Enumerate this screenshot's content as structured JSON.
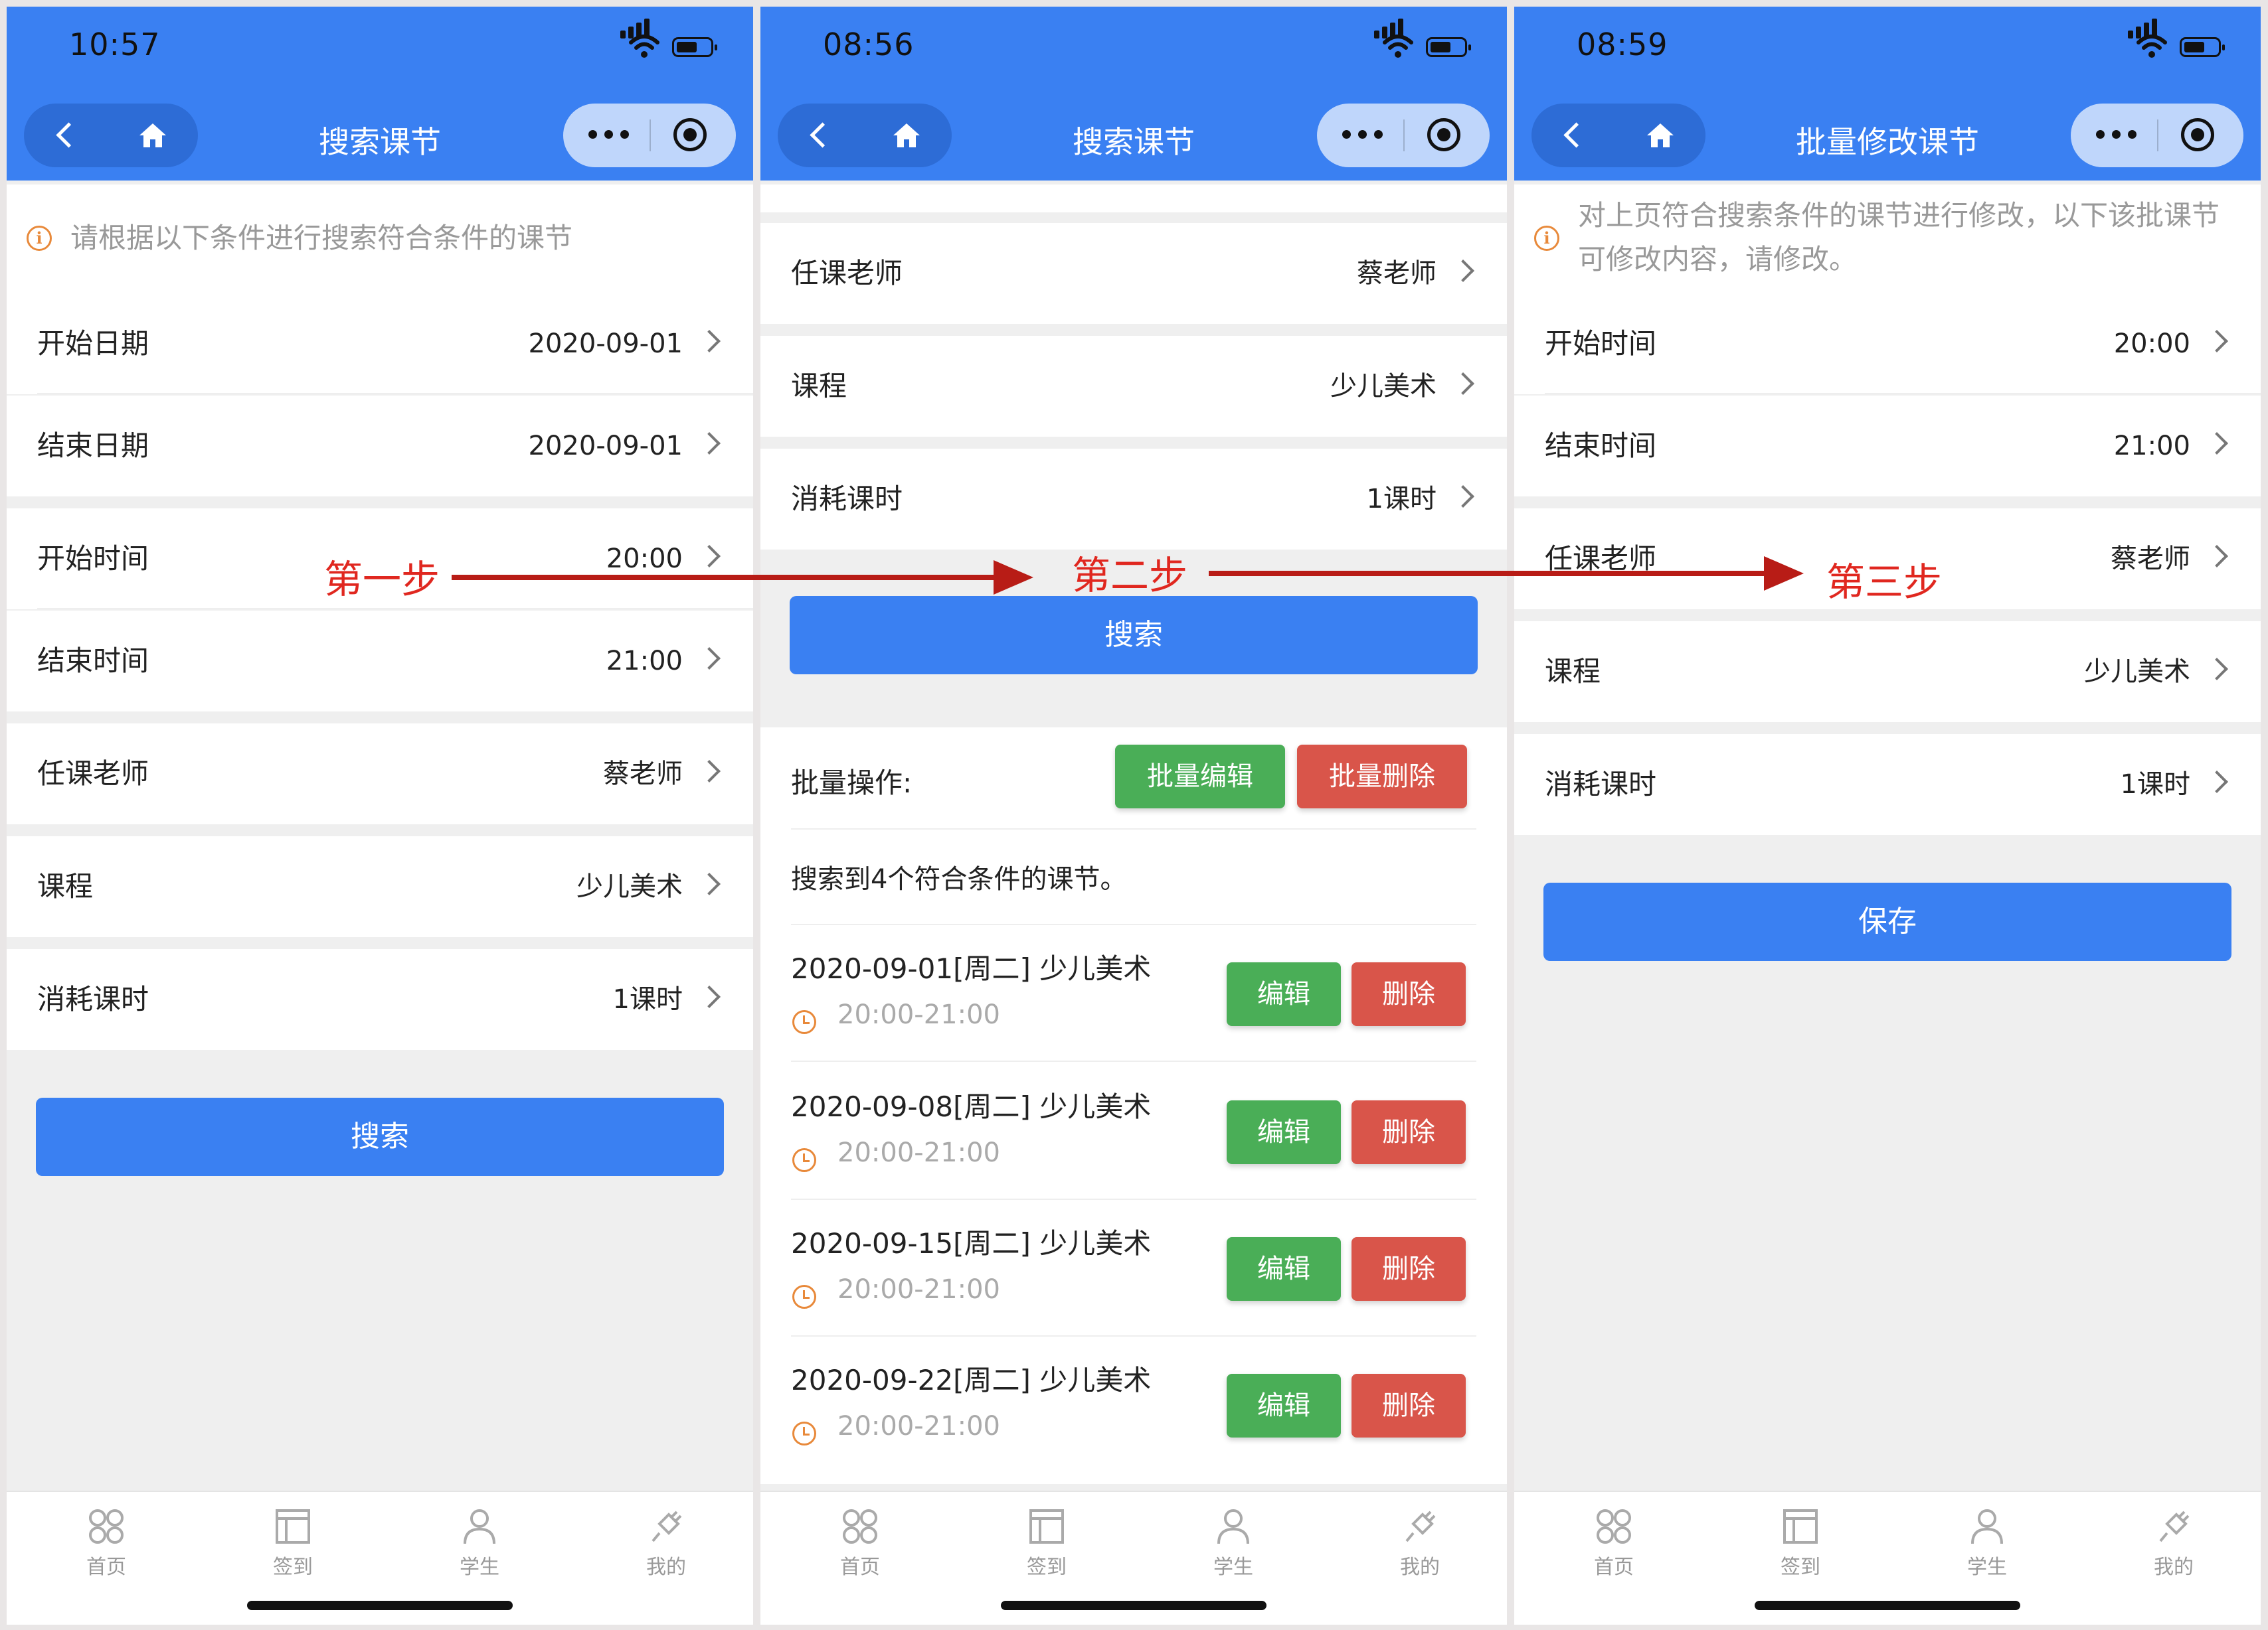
{
  "icons": {
    "back": "chevron-left-icon",
    "home": "home-icon",
    "more": "more-dots-icon",
    "close": "target-icon",
    "notice": "info-icon",
    "clock": "clock-icon",
    "tabs": [
      "grid-icon",
      "book-icon",
      "person-icon",
      "plug-icon"
    ]
  },
  "colors": {
    "primary": "#3a80f2",
    "success": "#4aae57",
    "danger": "#d9554a",
    "step_label": "#e0271f",
    "arrow": "#b81c16",
    "notice_icon": "#e8893a"
  },
  "tabbar": {
    "items": [
      {
        "label": "首页"
      },
      {
        "label": "签到"
      },
      {
        "label": "学生"
      },
      {
        "label": "我的"
      }
    ]
  },
  "steps": [
    "第一步",
    "第二步",
    "第三步"
  ],
  "screen1": {
    "time": "10:57",
    "title": "搜索课节",
    "notice": "请根据以下条件进行搜索符合条件的课节",
    "fields": [
      {
        "label": "开始日期",
        "value": "2020-09-01"
      },
      {
        "label": "结束日期",
        "value": "2020-09-01"
      },
      {
        "label": "开始时间",
        "value": "20:00"
      },
      {
        "label": "结束时间",
        "value": "21:00"
      },
      {
        "label": "任课老师",
        "value": "蔡老师"
      },
      {
        "label": "课程",
        "value": "少儿美术"
      },
      {
        "label": "消耗课时",
        "value": "1课时"
      }
    ],
    "search_button": "搜索"
  },
  "screen2": {
    "time": "08:56",
    "title": "搜索课节",
    "fields": [
      {
        "label": "任课老师",
        "value": "蔡老师"
      },
      {
        "label": "课程",
        "value": "少儿美术"
      },
      {
        "label": "消耗课时",
        "value": "1课时"
      }
    ],
    "search_button": "搜索",
    "batch_label": "批量操作:",
    "batch_edit": "批量编辑",
    "batch_delete": "批量删除",
    "result_summary": "搜索到4个符合条件的课节。",
    "edit_label": "编辑",
    "delete_label": "删除",
    "lessons": [
      {
        "title": "2020-09-01[周二] 少儿美术",
        "time": "20:00-21:00"
      },
      {
        "title": "2020-09-08[周二] 少儿美术",
        "time": "20:00-21:00"
      },
      {
        "title": "2020-09-15[周二] 少儿美术",
        "time": "20:00-21:00"
      },
      {
        "title": "2020-09-22[周二] 少儿美术",
        "time": "20:00-21:00"
      }
    ]
  },
  "screen3": {
    "time": "08:59",
    "title": "批量修改课节",
    "notice": "对上页符合搜索条件的课节进行修改，以下该批课节可修改内容，请修改。",
    "fields": [
      {
        "label": "开始时间",
        "value": "20:00"
      },
      {
        "label": "结束时间",
        "value": "21:00"
      },
      {
        "label": "任课老师",
        "value": "蔡老师"
      },
      {
        "label": "课程",
        "value": "少儿美术"
      },
      {
        "label": "消耗课时",
        "value": "1课时"
      }
    ],
    "save_button": "保存"
  }
}
